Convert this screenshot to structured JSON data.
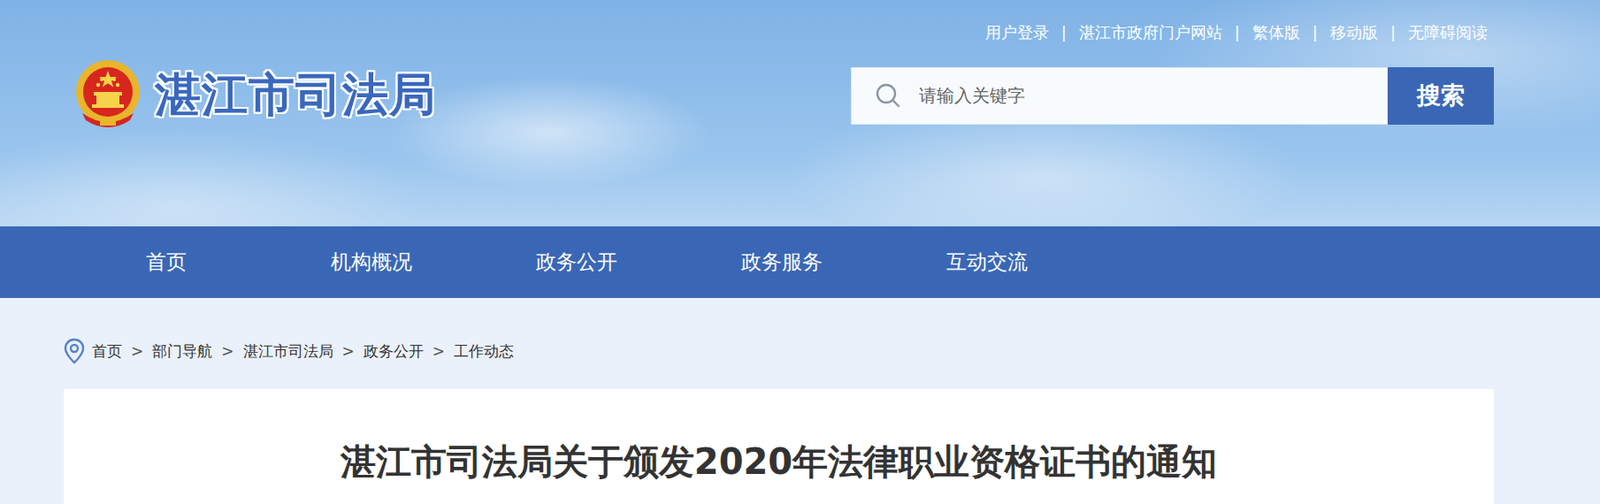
{
  "header": {
    "site_title": "湛江市司法局",
    "top_links": [
      "用户登录",
      "湛江市政府门户网站",
      "繁体版",
      "移动版",
      "无障碍阅读"
    ],
    "top_link_separator": "|"
  },
  "search": {
    "placeholder": "请输入关键字",
    "button": "搜索"
  },
  "nav": [
    {
      "label": "首页"
    },
    {
      "label": "机构概况"
    },
    {
      "label": "政务公开"
    },
    {
      "label": "政务服务"
    },
    {
      "label": "互动交流"
    }
  ],
  "breadcrumb": {
    "items": [
      "首页",
      "部门导航",
      "湛江市司法局",
      "政务公开",
      "工作动态"
    ],
    "separator": ">"
  },
  "article": {
    "title": "湛江市司法局关于颁发2020年法律职业资格证书的通知"
  }
}
